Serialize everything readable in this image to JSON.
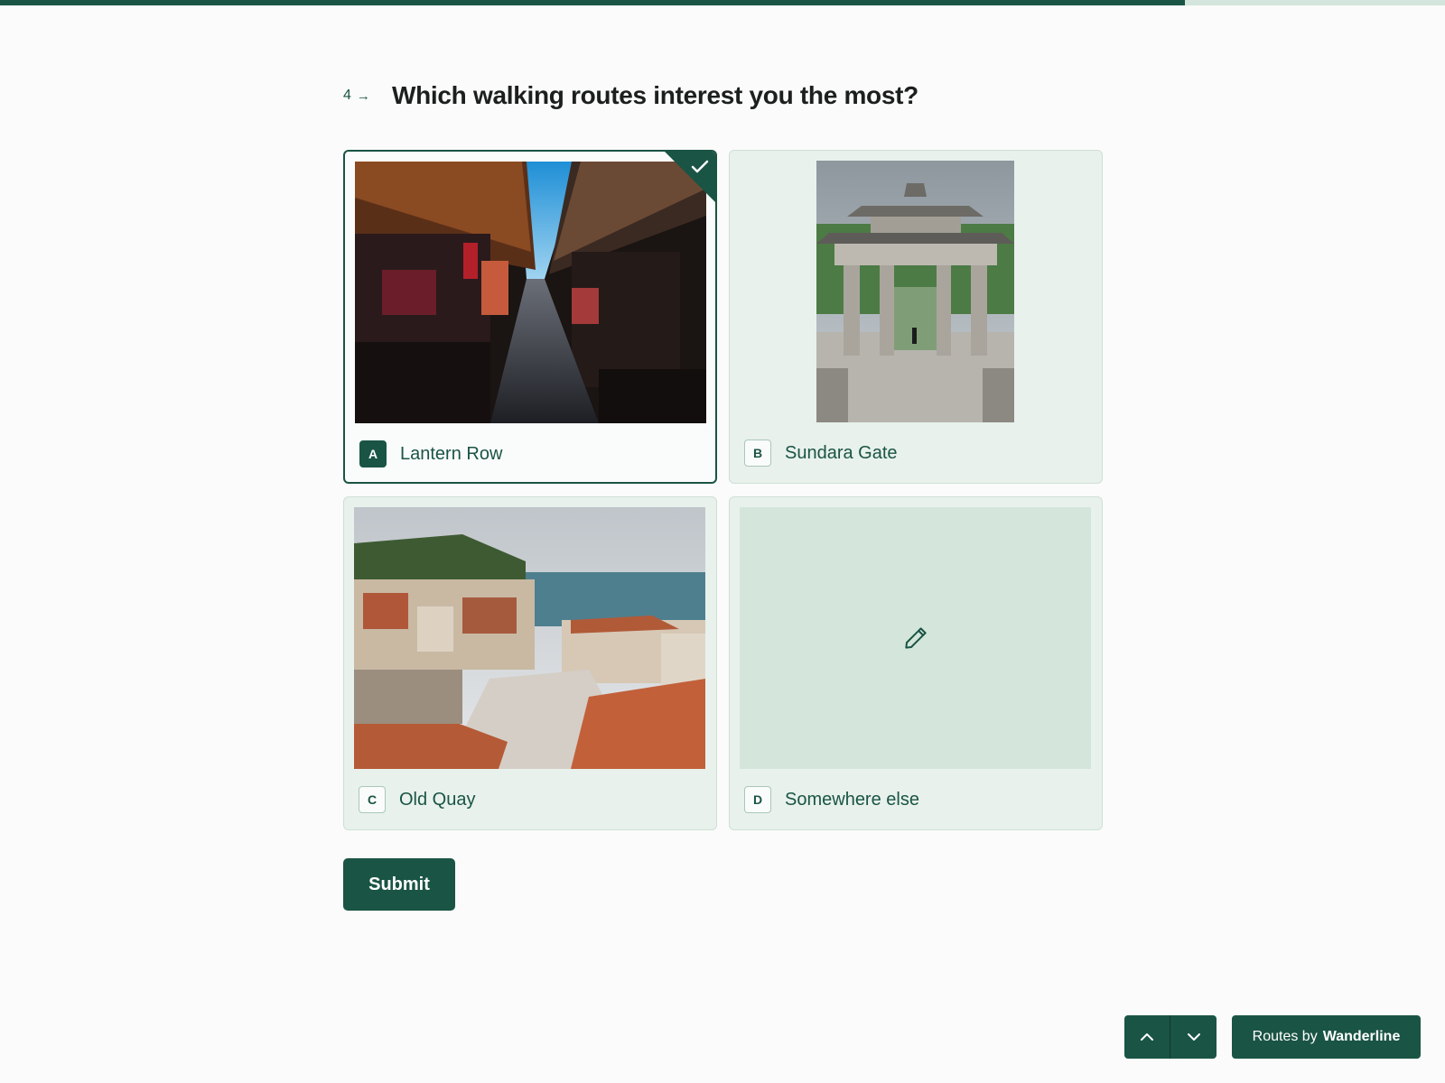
{
  "progress": {
    "fraction": 0.82
  },
  "question": {
    "number": "4",
    "arrow": "→",
    "title": "Which walking routes interest you the most?"
  },
  "options": [
    {
      "key": "A",
      "label": "Lantern Row",
      "selected": true,
      "image": "market-street-photo"
    },
    {
      "key": "B",
      "label": "Sundara Gate",
      "selected": false,
      "image": "stone-gate-photo"
    },
    {
      "key": "C",
      "label": "Old Quay",
      "selected": false,
      "image": "harbor-town-photo"
    },
    {
      "key": "D",
      "label": "Somewhere else",
      "selected": false,
      "image": "pencil-icon"
    }
  ],
  "submit_label": "Submit",
  "footer": {
    "brand_prefix": "Routes by",
    "brand_name": "Wanderline",
    "up_icon": "chevron-up-icon",
    "down_icon": "chevron-down-icon"
  },
  "colors": {
    "accent": "#1a5444",
    "card_bg": "#e8f1ec",
    "progress_track": "#d3e5dc",
    "page_bg": "#fafbfa"
  }
}
